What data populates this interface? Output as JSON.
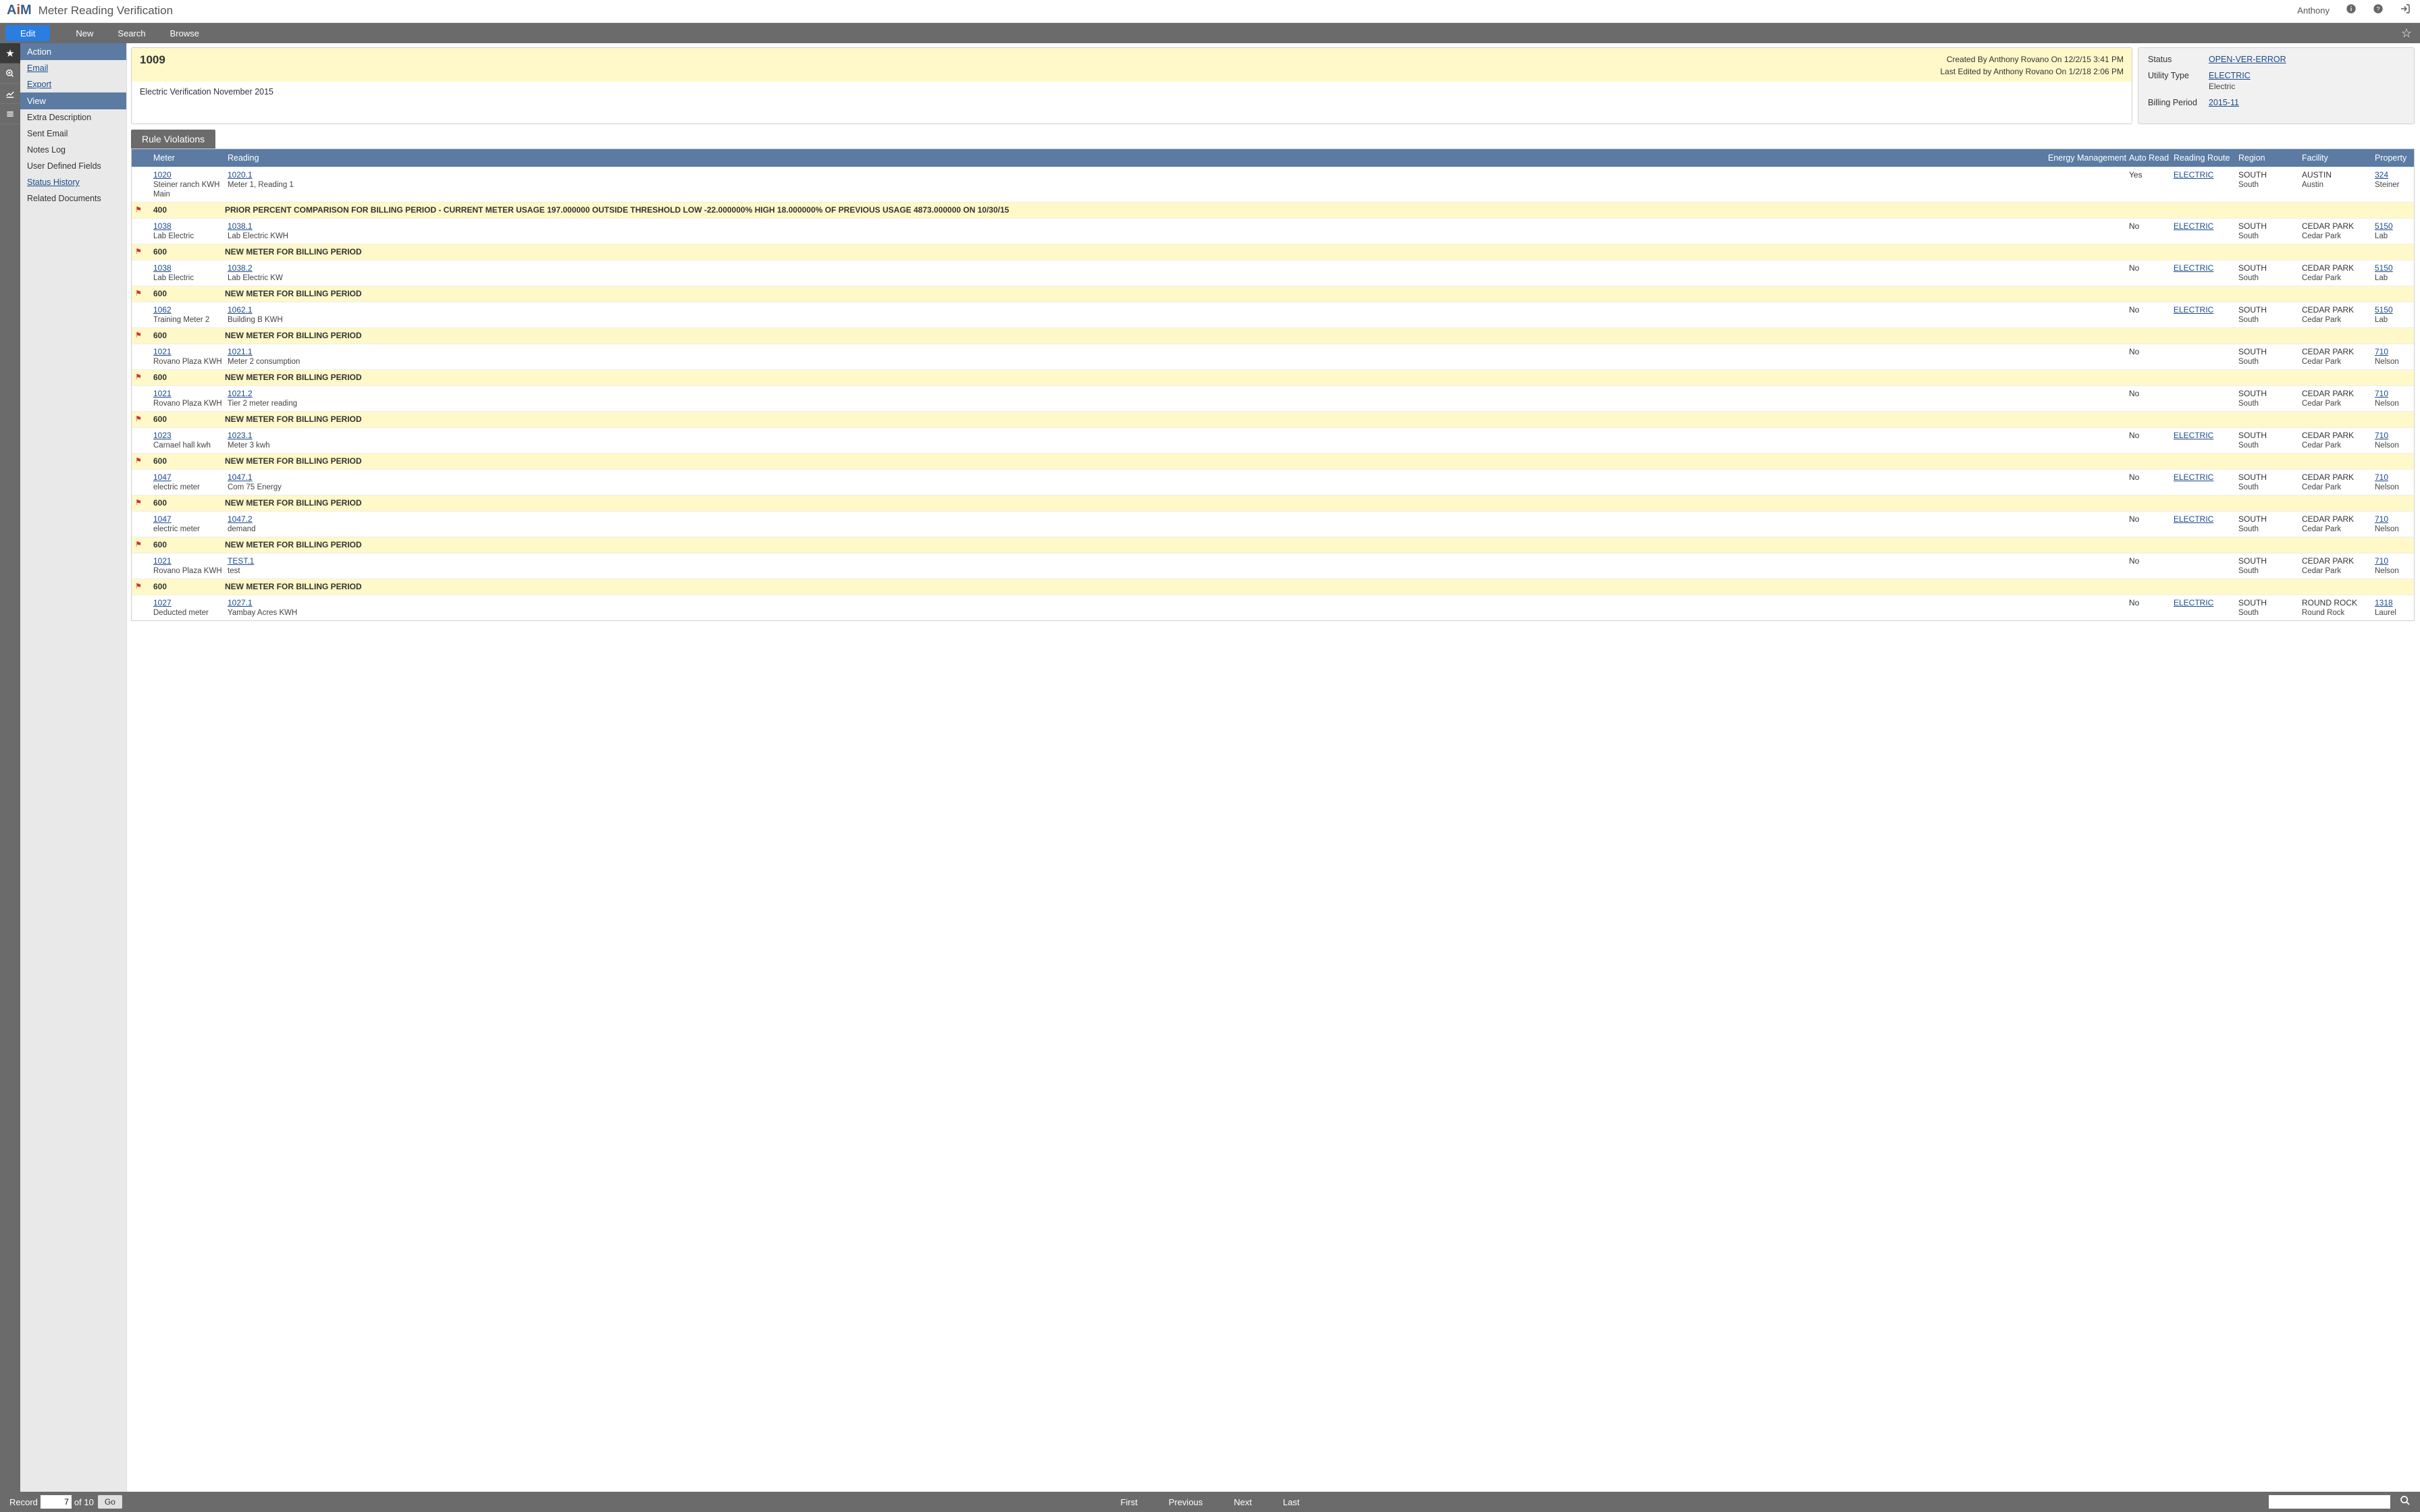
{
  "header": {
    "app_name_a": "A",
    "app_name_i": "i",
    "app_name_m": "M",
    "page_title": "Meter Reading Verification",
    "user": "Anthony"
  },
  "toolbar": {
    "edit": "Edit",
    "new": "New",
    "search": "Search",
    "browse": "Browse"
  },
  "side": {
    "action_label": "Action",
    "email": "Email",
    "export": "Export",
    "view_label": "View",
    "extra_desc": "Extra Description",
    "sent_email": "Sent Email",
    "notes_log": "Notes Log",
    "udf": "User Defined Fields",
    "status_history": "Status History",
    "related_docs": "Related Documents"
  },
  "record": {
    "id": "1009",
    "created": "Created By Anthony Rovano On 12/2/15 3:41 PM",
    "edited": "Last Edited by Anthony Rovano On 1/2/18 2:06 PM",
    "description": "Electric Verification November 2015"
  },
  "summary": {
    "status_label": "Status",
    "status_value": "OPEN-VER-ERROR",
    "utility_type_label": "Utility Type",
    "utility_type_link": "ELECTRIC",
    "utility_type_text": "Electric",
    "billing_period_label": "Billing Period",
    "billing_period_value": "2015-11"
  },
  "rv": {
    "title": "Rule Violations",
    "headers": {
      "meter": "Meter",
      "reading": "Reading",
      "energy_management": "Energy Management",
      "auto_read": "Auto Read",
      "reading_route": "Reading Route",
      "region": "Region",
      "facility": "Facility",
      "property": "Property"
    },
    "rows": [
      {
        "type": "data",
        "meter_link": "1020",
        "meter_text": "Steiner ranch KWH Main",
        "reading_link": "1020.1",
        "reading_text": "Meter 1, Reading 1",
        "auto_read": "Yes",
        "route": "ELECTRIC",
        "region1": "SOUTH",
        "region2": "South",
        "facility1": "AUSTIN",
        "facility2": "Austin",
        "property_link": "324",
        "property_text": "Steiner"
      },
      {
        "type": "violation",
        "code": "400",
        "msg": "PRIOR PERCENT COMPARISON FOR BILLING PERIOD - CURRENT METER USAGE 197.000000 OUTSIDE THRESHOLD LOW -22.000000% HIGH 18.000000% OF PREVIOUS USAGE 4873.000000 ON 10/30/15"
      },
      {
        "type": "data",
        "meter_link": "1038",
        "meter_text": "Lab Electric",
        "reading_link": "1038.1",
        "reading_text": "Lab Electric KWH",
        "auto_read": "No",
        "route": "ELECTRIC",
        "region1": "SOUTH",
        "region2": "South",
        "facility1": "CEDAR PARK",
        "facility2": "Cedar Park",
        "property_link": "5150",
        "property_text": "Lab"
      },
      {
        "type": "violation",
        "code": "600",
        "msg": "NEW METER FOR BILLING PERIOD"
      },
      {
        "type": "data",
        "meter_link": "1038",
        "meter_text": "Lab Electric",
        "reading_link": "1038.2",
        "reading_text": "Lab Electric KW",
        "auto_read": "No",
        "route": "ELECTRIC",
        "region1": "SOUTH",
        "region2": "South",
        "facility1": "CEDAR PARK",
        "facility2": "Cedar Park",
        "property_link": "5150",
        "property_text": "Lab"
      },
      {
        "type": "violation",
        "code": "600",
        "msg": "NEW METER FOR BILLING PERIOD"
      },
      {
        "type": "data",
        "meter_link": "1062",
        "meter_text": "Training Meter 2",
        "reading_link": "1062.1",
        "reading_text": "Building B KWH",
        "auto_read": "No",
        "route": "ELECTRIC",
        "region1": "SOUTH",
        "region2": "South",
        "facility1": "CEDAR PARK",
        "facility2": "Cedar Park",
        "property_link": "5150",
        "property_text": "Lab"
      },
      {
        "type": "violation",
        "code": "600",
        "msg": "NEW METER FOR BILLING PERIOD"
      },
      {
        "type": "data",
        "meter_link": "1021",
        "meter_text": "Rovano Plaza KWH",
        "reading_link": "1021.1",
        "reading_text": "Meter 2 consumption",
        "auto_read": "No",
        "route": "",
        "region1": "SOUTH",
        "region2": "South",
        "facility1": "CEDAR PARK",
        "facility2": "Cedar Park",
        "property_link": "710",
        "property_text": "Nelson"
      },
      {
        "type": "violation",
        "code": "600",
        "msg": "NEW METER FOR BILLING PERIOD"
      },
      {
        "type": "data",
        "meter_link": "1021",
        "meter_text": "Rovano Plaza KWH",
        "reading_link": "1021.2",
        "reading_text": "Tier 2 meter reading",
        "auto_read": "No",
        "route": "",
        "region1": "SOUTH",
        "region2": "South",
        "facility1": "CEDAR PARK",
        "facility2": "Cedar Park",
        "property_link": "710",
        "property_text": "Nelson"
      },
      {
        "type": "violation",
        "code": "600",
        "msg": "NEW METER FOR BILLING PERIOD"
      },
      {
        "type": "data",
        "meter_link": "1023",
        "meter_text": "Carnael hall kwh",
        "reading_link": "1023.1",
        "reading_text": "Meter 3 kwh",
        "auto_read": "No",
        "route": "ELECTRIC",
        "region1": "SOUTH",
        "region2": "South",
        "facility1": "CEDAR PARK",
        "facility2": "Cedar Park",
        "property_link": "710",
        "property_text": "Nelson"
      },
      {
        "type": "violation",
        "code": "600",
        "msg": "NEW METER FOR BILLING PERIOD"
      },
      {
        "type": "data",
        "meter_link": "1047",
        "meter_text": "electric meter",
        "reading_link": "1047.1",
        "reading_text": "Com 75 Energy",
        "auto_read": "No",
        "route": "ELECTRIC",
        "region1": "SOUTH",
        "region2": "South",
        "facility1": "CEDAR PARK",
        "facility2": "Cedar Park",
        "property_link": "710",
        "property_text": "Nelson"
      },
      {
        "type": "violation",
        "code": "600",
        "msg": "NEW METER FOR BILLING PERIOD"
      },
      {
        "type": "data",
        "meter_link": "1047",
        "meter_text": "electric meter",
        "reading_link": "1047.2",
        "reading_text": "demand",
        "auto_read": "No",
        "route": "ELECTRIC",
        "region1": "SOUTH",
        "region2": "South",
        "facility1": "CEDAR PARK",
        "facility2": "Cedar Park",
        "property_link": "710",
        "property_text": "Nelson"
      },
      {
        "type": "violation",
        "code": "600",
        "msg": "NEW METER FOR BILLING PERIOD"
      },
      {
        "type": "data",
        "meter_link": "1021",
        "meter_text": "Rovano Plaza KWH",
        "reading_link": "TEST.1",
        "reading_text": "test",
        "auto_read": "No",
        "route": "",
        "region1": "SOUTH",
        "region2": "South",
        "facility1": "CEDAR PARK",
        "facility2": "Cedar Park",
        "property_link": "710",
        "property_text": "Nelson"
      },
      {
        "type": "violation",
        "code": "600",
        "msg": "NEW METER FOR BILLING PERIOD"
      },
      {
        "type": "data",
        "meter_link": "1027",
        "meter_text": "Deducted meter",
        "reading_link": "1027.1",
        "reading_text": "Yambay Acres KWH",
        "auto_read": "No",
        "route": "ELECTRIC",
        "region1": "SOUTH",
        "region2": "South",
        "facility1": "ROUND ROCK",
        "facility2": "Round Rock",
        "property_link": "1318",
        "property_text": "Laurel"
      }
    ]
  },
  "footer": {
    "record_label": "Record",
    "record_value": "7",
    "of_label": "of 10",
    "go": "Go",
    "first": "First",
    "previous": "Previous",
    "next": "Next",
    "last": "Last"
  }
}
